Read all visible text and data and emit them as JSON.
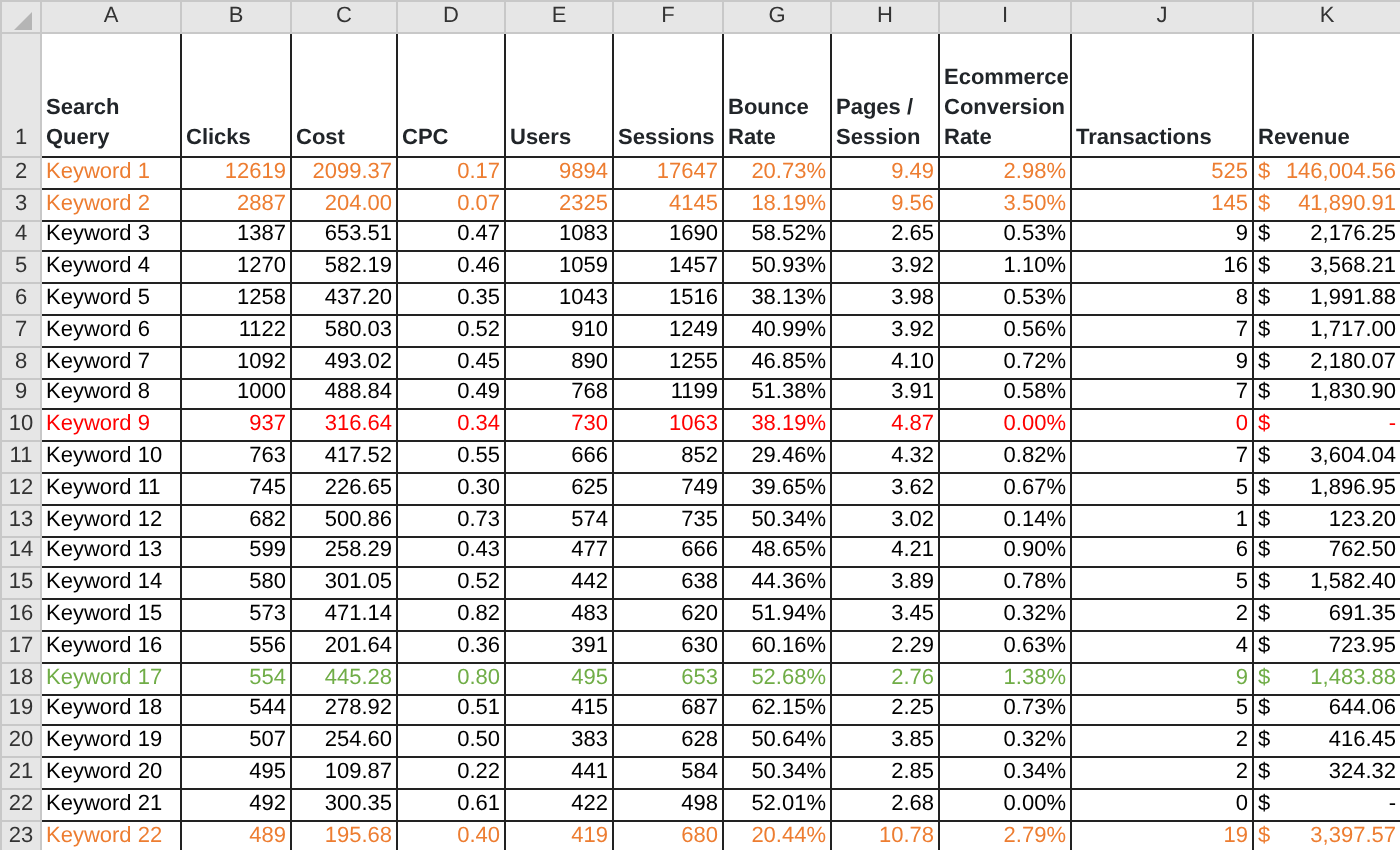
{
  "column_letters": [
    "A",
    "B",
    "C",
    "D",
    "E",
    "F",
    "G",
    "H",
    "I",
    "J",
    "K"
  ],
  "header_row": {
    "number": "1",
    "headings": [
      "Search Query",
      "Clicks",
      "Cost",
      "CPC",
      "Users",
      "Sessions",
      "Bounce Rate",
      "Pages / Session",
      "Ecommerce Conversion Rate",
      "Transactions",
      "Revenue"
    ]
  },
  "rows": [
    {
      "number": "2",
      "color": "#ed7d31",
      "cells": [
        "Keyword 1",
        "12619",
        "2099.37",
        "0.17",
        "9894",
        "17647",
        "20.73%",
        "9.49",
        "2.98%",
        "525"
      ],
      "revenue": {
        "symbol": "$",
        "amount": "146,004.56"
      }
    },
    {
      "number": "3",
      "color": "#ed7d31",
      "cells": [
        "Keyword 2",
        "2887",
        "204.00",
        "0.07",
        "2325",
        "4145",
        "18.19%",
        "9.56",
        "3.50%",
        "145"
      ],
      "revenue": {
        "symbol": "$",
        "amount": "41,890.91"
      }
    },
    {
      "number": "4",
      "color": "#000000",
      "cells": [
        "Keyword 3",
        "1387",
        "653.51",
        "0.47",
        "1083",
        "1690",
        "58.52%",
        "2.65",
        "0.53%",
        "9"
      ],
      "revenue": {
        "symbol": "$",
        "amount": "2,176.25"
      }
    },
    {
      "number": "5",
      "color": "#000000",
      "cells": [
        "Keyword 4",
        "1270",
        "582.19",
        "0.46",
        "1059",
        "1457",
        "50.93%",
        "3.92",
        "1.10%",
        "16"
      ],
      "revenue": {
        "symbol": "$",
        "amount": "3,568.21"
      }
    },
    {
      "number": "6",
      "color": "#000000",
      "cells": [
        "Keyword 5",
        "1258",
        "437.20",
        "0.35",
        "1043",
        "1516",
        "38.13%",
        "3.98",
        "0.53%",
        "8"
      ],
      "revenue": {
        "symbol": "$",
        "amount": "1,991.88"
      }
    },
    {
      "number": "7",
      "color": "#000000",
      "cells": [
        "Keyword 6",
        "1122",
        "580.03",
        "0.52",
        "910",
        "1249",
        "40.99%",
        "3.92",
        "0.56%",
        "7"
      ],
      "revenue": {
        "symbol": "$",
        "amount": "1,717.00"
      }
    },
    {
      "number": "8",
      "color": "#000000",
      "cells": [
        "Keyword 7",
        "1092",
        "493.02",
        "0.45",
        "890",
        "1255",
        "46.85%",
        "4.10",
        "0.72%",
        "9"
      ],
      "revenue": {
        "symbol": "$",
        "amount": "2,180.07"
      }
    },
    {
      "number": "9",
      "color": "#000000",
      "cells": [
        "Keyword 8",
        "1000",
        "488.84",
        "0.49",
        "768",
        "1199",
        "51.38%",
        "3.91",
        "0.58%",
        "7"
      ],
      "revenue": {
        "symbol": "$",
        "amount": "1,830.90"
      }
    },
    {
      "number": "10",
      "color": "#ff0000",
      "cells": [
        "Keyword 9",
        "937",
        "316.64",
        "0.34",
        "730",
        "1063",
        "38.19%",
        "4.87",
        "0.00%",
        "0"
      ],
      "revenue": {
        "symbol": "$",
        "amount": "-"
      }
    },
    {
      "number": "11",
      "color": "#000000",
      "cells": [
        "Keyword 10",
        "763",
        "417.52",
        "0.55",
        "666",
        "852",
        "29.46%",
        "4.32",
        "0.82%",
        "7"
      ],
      "revenue": {
        "symbol": "$",
        "amount": "3,604.04"
      }
    },
    {
      "number": "12",
      "color": "#000000",
      "cells": [
        "Keyword 11",
        "745",
        "226.65",
        "0.30",
        "625",
        "749",
        "39.65%",
        "3.62",
        "0.67%",
        "5"
      ],
      "revenue": {
        "symbol": "$",
        "amount": "1,896.95"
      }
    },
    {
      "number": "13",
      "color": "#000000",
      "cells": [
        "Keyword 12",
        "682",
        "500.86",
        "0.73",
        "574",
        "735",
        "50.34%",
        "3.02",
        "0.14%",
        "1"
      ],
      "revenue": {
        "symbol": "$",
        "amount": "123.20"
      }
    },
    {
      "number": "14",
      "color": "#000000",
      "cells": [
        "Keyword 13",
        "599",
        "258.29",
        "0.43",
        "477",
        "666",
        "48.65%",
        "4.21",
        "0.90%",
        "6"
      ],
      "revenue": {
        "symbol": "$",
        "amount": "762.50"
      }
    },
    {
      "number": "15",
      "color": "#000000",
      "cells": [
        "Keyword 14",
        "580",
        "301.05",
        "0.52",
        "442",
        "638",
        "44.36%",
        "3.89",
        "0.78%",
        "5"
      ],
      "revenue": {
        "symbol": "$",
        "amount": "1,582.40"
      }
    },
    {
      "number": "16",
      "color": "#000000",
      "cells": [
        "Keyword 15",
        "573",
        "471.14",
        "0.82",
        "483",
        "620",
        "51.94%",
        "3.45",
        "0.32%",
        "2"
      ],
      "revenue": {
        "symbol": "$",
        "amount": "691.35"
      }
    },
    {
      "number": "17",
      "color": "#000000",
      "cells": [
        "Keyword 16",
        "556",
        "201.64",
        "0.36",
        "391",
        "630",
        "60.16%",
        "2.29",
        "0.63%",
        "4"
      ],
      "revenue": {
        "symbol": "$",
        "amount": "723.95"
      }
    },
    {
      "number": "18",
      "color": "#70ad47",
      "cells": [
        "Keyword 17",
        "554",
        "445.28",
        "0.80",
        "495",
        "653",
        "52.68%",
        "2.76",
        "1.38%",
        "9"
      ],
      "revenue": {
        "symbol": "$",
        "amount": "1,483.88"
      }
    },
    {
      "number": "19",
      "color": "#000000",
      "cells": [
        "Keyword 18",
        "544",
        "278.92",
        "0.51",
        "415",
        "687",
        "62.15%",
        "2.25",
        "0.73%",
        "5"
      ],
      "revenue": {
        "symbol": "$",
        "amount": "644.06"
      }
    },
    {
      "number": "20",
      "color": "#000000",
      "cells": [
        "Keyword 19",
        "507",
        "254.60",
        "0.50",
        "383",
        "628",
        "50.64%",
        "3.85",
        "0.32%",
        "2"
      ],
      "revenue": {
        "symbol": "$",
        "amount": "416.45"
      }
    },
    {
      "number": "21",
      "color": "#000000",
      "cells": [
        "Keyword 20",
        "495",
        "109.87",
        "0.22",
        "441",
        "584",
        "50.34%",
        "2.85",
        "0.34%",
        "2"
      ],
      "revenue": {
        "symbol": "$",
        "amount": "324.32"
      }
    },
    {
      "number": "22",
      "color": "#000000",
      "cells": [
        "Keyword 21",
        "492",
        "300.35",
        "0.61",
        "422",
        "498",
        "52.01%",
        "2.68",
        "0.00%",
        "0"
      ],
      "revenue": {
        "symbol": "$",
        "amount": "-"
      }
    },
    {
      "number": "23",
      "color": "#ed7d31",
      "cells": [
        "Keyword 22",
        "489",
        "195.68",
        "0.40",
        "419",
        "680",
        "20.44%",
        "10.78",
        "2.79%",
        "19"
      ],
      "revenue": {
        "symbol": "$",
        "amount": "3,397.57"
      }
    }
  ]
}
